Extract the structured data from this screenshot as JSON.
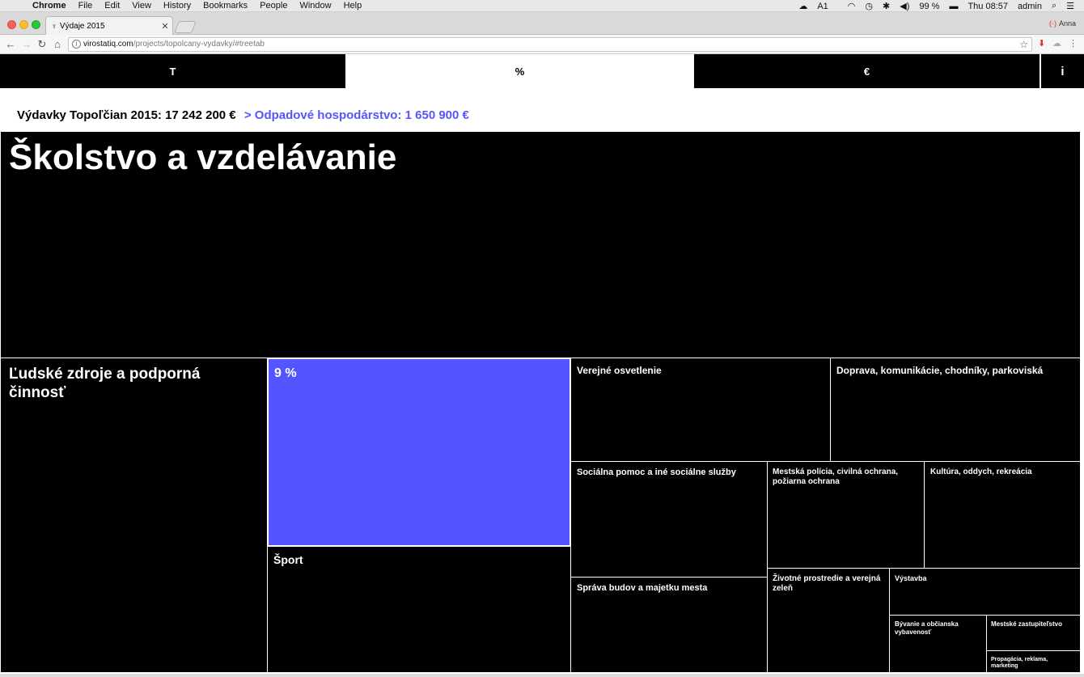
{
  "system_menu": {
    "app": "Chrome",
    "items": [
      "File",
      "Edit",
      "View",
      "History",
      "Bookmarks",
      "People",
      "Window",
      "Help"
    ],
    "status": {
      "badge": "1",
      "battery": "99 %",
      "clock": "Thu 08:57",
      "user": "admin"
    }
  },
  "browser": {
    "tab_title": "Výdaje 2015",
    "profile_name": "Anna",
    "url_host": "virostatiq.com",
    "url_path": "/projects/topolcany-vydavky/#treetab"
  },
  "nav": {
    "items": [
      {
        "label": "T",
        "active": false
      },
      {
        "label": "%",
        "active": true
      },
      {
        "label": "€",
        "active": false
      },
      {
        "label": "i",
        "active": false
      }
    ]
  },
  "breadcrumb": {
    "root": "Výdavky Topoľčian 2015: 17 242 200 €",
    "current": "> Odpadové hospodárstvo: 1 650 900 €"
  },
  "treemap": {
    "accent_color": "#5555ff",
    "cells": {
      "skolstvo": "Školstvo a vzdelávanie",
      "ludske": "Ľudské zdroje a podporná činnosť",
      "odpad_pct": "9 %",
      "sport": "Šport",
      "osvetlenie": "Verejné osvetlenie",
      "doprava": "Doprava, komunikácie, chodníky, parkoviská",
      "socialna": "Sociálna pomoc a iné sociálne služby",
      "policia": "Mestská polícia, civilná ochrana, požiarna ochrana",
      "kultura": "Kultúra, oddych, rekreácia",
      "sprava": "Správa budov a majetku mesta",
      "zivotne": "Životné prostredie a verejná zeleň",
      "vystavba": "Výstavba",
      "byvanie": "Bývanie a občianska vybavenosť",
      "zastupitelstvo": "Mestské zastupiteľstvo",
      "propagacia": "Propagácia, reklama, marketing"
    }
  }
}
